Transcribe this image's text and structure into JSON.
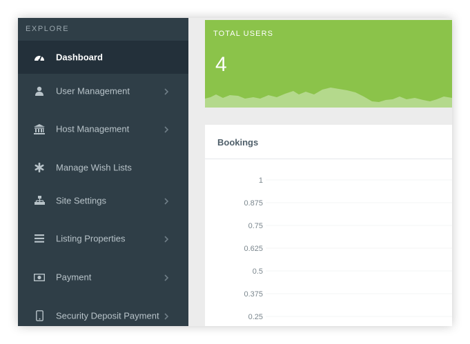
{
  "sidebar": {
    "heading": "EXPLORE",
    "items": [
      {
        "label": "Dashboard",
        "icon": "dashboard-icon",
        "active": true
      },
      {
        "label": "User Management",
        "icon": "user-icon"
      },
      {
        "label": "Host Management",
        "icon": "bank-icon"
      },
      {
        "label": "Manage Wish Lists",
        "icon": "asterisk-icon"
      },
      {
        "label": "Site Settings",
        "icon": "sitemap-icon"
      },
      {
        "label": "Listing Properties",
        "icon": "list-icon"
      },
      {
        "label": "Payment",
        "icon": "money-icon"
      },
      {
        "label": "Security Deposit Payment",
        "icon": "mobile-icon"
      }
    ]
  },
  "stats": {
    "title": "TOTAL USERS",
    "value": "4"
  },
  "bookings": {
    "title": "Bookings"
  },
  "chart_data": {
    "type": "line",
    "title": "Bookings",
    "y_ticks": [
      "1",
      "0.875",
      "0.75",
      "0.625",
      "0.5",
      "0.375",
      "0.25"
    ],
    "ylim": [
      0.25,
      1
    ],
    "grid": true
  },
  "colors": {
    "sidebar_bg": "#2f3e47",
    "sidebar_active_bg": "#23303a",
    "stat_green": "#8bc34a",
    "text_muted": "#b8c3c9"
  }
}
